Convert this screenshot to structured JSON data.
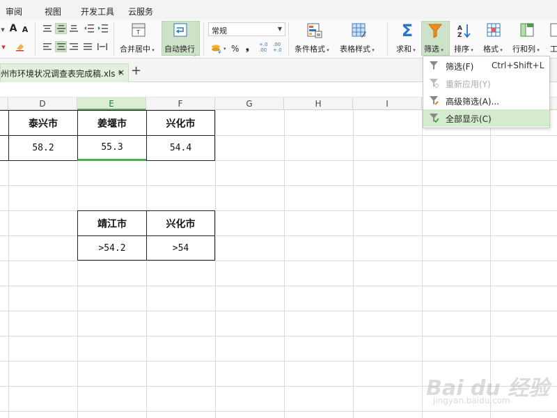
{
  "menu": {
    "tabs": [
      "审阅",
      "视图",
      "开发工具",
      "云服务"
    ]
  },
  "ribbon": {
    "merge_label": "合并居中",
    "wrap_label": "自动换行",
    "number_format": "常规",
    "percent": "%",
    "thousands": "❟",
    "dec_increase": "+.0 .00",
    "dec_decrease": ".00 +.0",
    "cond_format_label": "条件格式",
    "table_style_label": "表格样式",
    "sum_label": "求和",
    "filter_label": "筛选",
    "sort_label": "排序",
    "format_label": "格式",
    "rowcol_label": "行和列",
    "work_label": "工",
    "font_grow": "A",
    "font_shrink": "A"
  },
  "document": {
    "tab_title": "州市环境状况调查表完成稿.xls *",
    "close": "×",
    "new_tab": "+"
  },
  "columns": [
    "D",
    "E",
    "F",
    "G",
    "H",
    "I"
  ],
  "table1": {
    "headers": [
      "泰兴市",
      "姜堰市",
      "兴化市"
    ],
    "values": [
      "58.2",
      "55.3",
      "54.4"
    ]
  },
  "table2": {
    "headers": [
      "靖江市",
      "兴化市"
    ],
    "values": [
      ">54.2",
      ">54"
    ]
  },
  "filter_menu": {
    "items": [
      {
        "label": "筛选(F)",
        "shortcut": "Ctrl+Shift+L"
      },
      {
        "label": "重新应用(Y)",
        "shortcut": ""
      },
      {
        "label": "高级筛选(A)...",
        "shortcut": ""
      },
      {
        "label": "全部显示(C)",
        "shortcut": ""
      }
    ]
  },
  "watermark": {
    "brand": "Bai du 经验",
    "url": "jingyan.baidu.com"
  },
  "colors": {
    "accent_green": "#5fa85b",
    "highlight": "#cde3c8",
    "filter_orange": "#f08c1e",
    "sum_blue": "#2a74c9"
  }
}
